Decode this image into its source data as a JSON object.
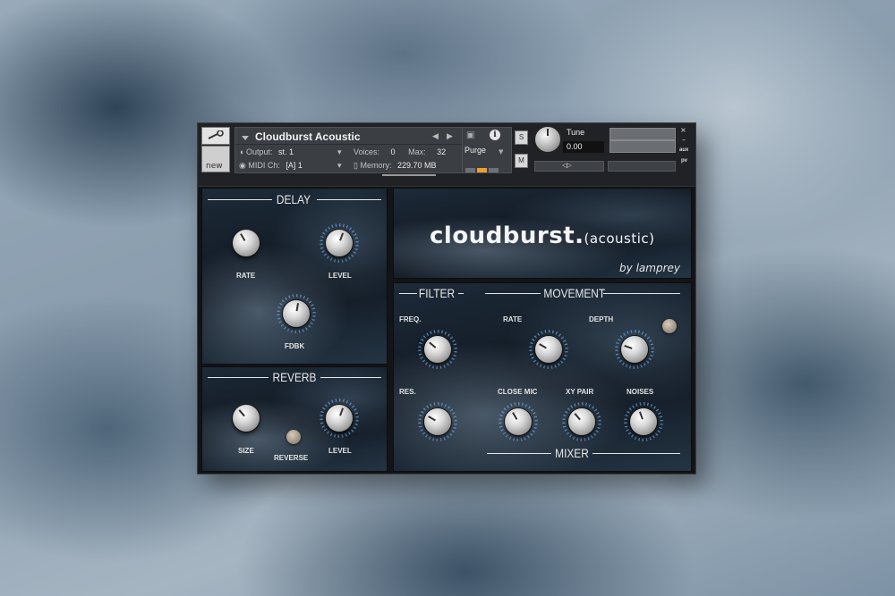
{
  "header": {
    "instrument_name": "Cloudburst Acoustic",
    "output_label": "Output:",
    "output_value": "st. 1",
    "midi_label": "MIDI Ch:",
    "midi_value": "[A]  1",
    "voices_label": "Voices:",
    "voices_value": "0",
    "max_label": "Max:",
    "max_value": "32",
    "memory_label": "Memory:",
    "memory_value": "229.70 MB",
    "purge_label": "Purge",
    "solo_label": "S",
    "mute_label": "M",
    "tune_label": "Tune",
    "tune_value": "0.00",
    "pan_label": "◁▷",
    "close_label": "×",
    "minimize_label": "–",
    "aux_label": "aux",
    "pv_label": "pv",
    "new_label": "new"
  },
  "branding": {
    "title": "cloudburst.",
    "subtitle": "(acoustic)",
    "byline": "by lamprey"
  },
  "delay": {
    "title": "DELAY",
    "rate_label": "RATE",
    "level_label": "LEVEL",
    "fdbk_label": "FDBK"
  },
  "reverb": {
    "title": "REVERB",
    "size_label": "SIZE",
    "reverse_label": "REVERSE",
    "level_label": "LEVEL"
  },
  "filter": {
    "title": "FILTER",
    "freq_label": "FREQ.",
    "res_label": "RES."
  },
  "movement": {
    "title": "MOVEMENT",
    "rate_label": "RATE",
    "depth_label": "DEPTH"
  },
  "mixer": {
    "title": "MIXER",
    "close_mic_label": "CLOSE MIC",
    "xy_pair_label": "XY PAIR",
    "noises_label": "NOISES"
  },
  "colors": {
    "ring_accent": "#6eaae6",
    "meter_active": "#e8a030",
    "window_bg": "#121417"
  },
  "icons": [
    "wrench-icon",
    "camera-icon",
    "info-icon",
    "chevron-down-icon",
    "arrow-left-icon",
    "arrow-right-icon",
    "speaker-icon",
    "midi-icon",
    "memory-icon"
  ]
}
